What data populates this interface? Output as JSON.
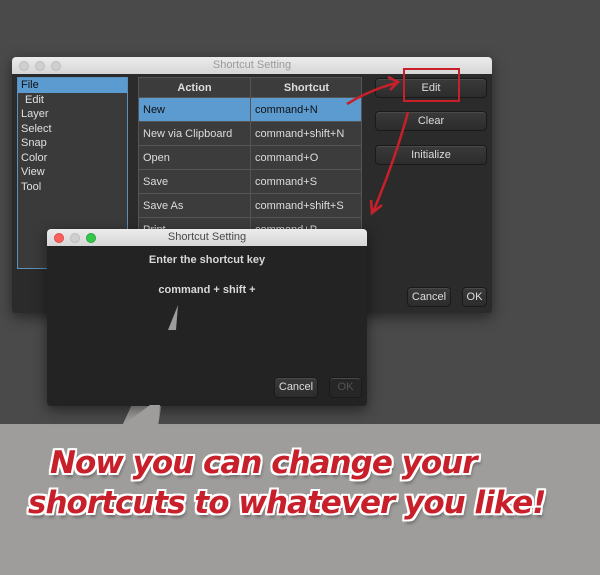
{
  "main_window": {
    "title": "Shortcut Setting",
    "categories": [
      "File",
      "Edit",
      "Layer",
      "Select",
      "Snap",
      "Color",
      "View",
      "Tool"
    ],
    "table": {
      "headers": [
        "Action",
        "Shortcut"
      ],
      "rows": [
        [
          "New",
          "command+N"
        ],
        [
          "New via Clipboard",
          "command+shift+N"
        ],
        [
          "Open",
          "command+O"
        ],
        [
          "Save",
          "command+S"
        ],
        [
          "Save As",
          "command+shift+S"
        ],
        [
          "Print",
          "command+P"
        ]
      ]
    },
    "buttons": {
      "edit": "Edit",
      "clear": "Clear",
      "initialize": "Initialize",
      "cancel": "Cancel",
      "ok": "OK"
    }
  },
  "dialog": {
    "title": "Shortcut Setting",
    "prompt": "Enter the shortcut key",
    "current": "command + shift +",
    "cancel": "Cancel",
    "ok": "OK"
  },
  "caption": {
    "line1": "Now you can change your",
    "line2": "shortcuts to whatever you like!"
  },
  "colors": {
    "accent": "#5b9bd0",
    "annotation": "#c8202a"
  }
}
